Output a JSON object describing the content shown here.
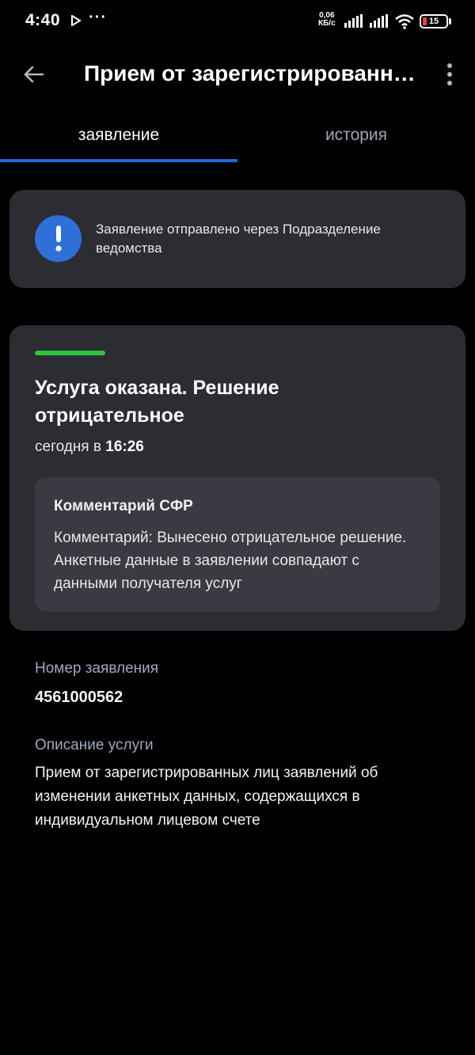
{
  "status_bar": {
    "time": "4:40",
    "dots": "···",
    "speed_value": "0,06",
    "speed_unit": "КБ/с",
    "battery": "15"
  },
  "app_bar": {
    "title": "Прием от зарегистрированн…"
  },
  "tabs": [
    {
      "label": "заявление",
      "active": true
    },
    {
      "label": "история",
      "active": false
    }
  ],
  "notice": {
    "text": "Заявление отправлено через Подразделение ведомства"
  },
  "status": {
    "title": "Услуга оказана. Решение отрицательное",
    "time_prefix": "сегодня в",
    "time_value": "16:26",
    "comment_title": "Комментарий СФР",
    "comment_text": "Комментарий: Вынесено отрицательное решение. Анкетные данные в заявлении совпадают с данными получателя услуг"
  },
  "details": {
    "number_label": "Номер заявления",
    "number_value": "4561000562",
    "description_label": "Описание услуги",
    "description_value": "Прием от зарегистрированных лиц заявлений об изменении анкетных данных, содержащихся в индивидуальном лицевом счете"
  },
  "colors": {
    "accent_blue": "#1e6fe0",
    "success_green": "#2ac43a",
    "card_bg": "#2c2d33",
    "battery_low": "#e8413a"
  }
}
